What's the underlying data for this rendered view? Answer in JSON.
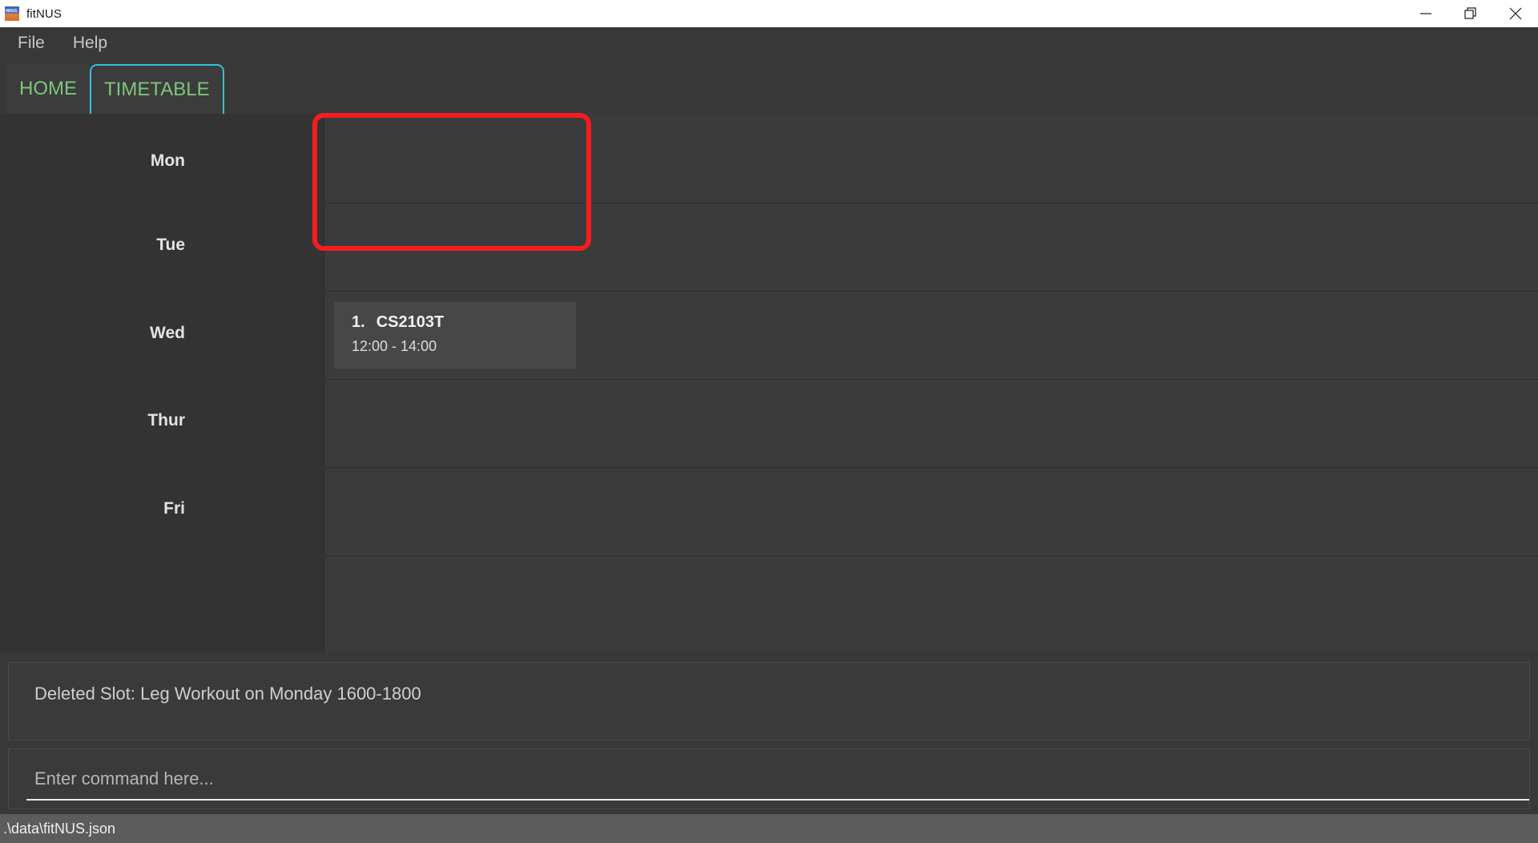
{
  "window": {
    "title": "fitNUS",
    "logo_icon": "fitnus-logo",
    "controls": [
      {
        "name": "minimize-button",
        "icon": "minimize-icon"
      },
      {
        "name": "restore-button",
        "icon": "restore-icon"
      },
      {
        "name": "close-button",
        "icon": "close-icon"
      }
    ]
  },
  "menubar": {
    "items": [
      {
        "label": "File",
        "name": "menu-file"
      },
      {
        "label": "Help",
        "name": "menu-help"
      }
    ]
  },
  "tabs": {
    "items": [
      {
        "label": "HOME",
        "name": "tab-home",
        "selected": false
      },
      {
        "label": "TIMETABLE",
        "name": "tab-timetable",
        "selected": true
      }
    ],
    "selected_border_color": "#2ec4d6",
    "selected_underline_color": "#f4887c",
    "text_color": "#7dc67d"
  },
  "timetable": {
    "days": [
      {
        "label": "Mon",
        "slots": []
      },
      {
        "label": "Tue",
        "slots": []
      },
      {
        "label": "Wed",
        "slots": [
          {
            "index": "1.",
            "name": "CS2103T",
            "time": "12:00 - 14:00"
          }
        ]
      },
      {
        "label": "Thur",
        "slots": []
      },
      {
        "label": "Fri",
        "slots": []
      }
    ]
  },
  "result": {
    "text": "Deleted Slot: Leg Workout on Monday 1600-1800"
  },
  "command": {
    "value": "",
    "placeholder": "Enter command here..."
  },
  "statusbar": {
    "path": ".\\data\\fitNUS.json"
  },
  "annotation": {
    "color": "#f41d1d",
    "target": "mon-row-grid-area"
  }
}
